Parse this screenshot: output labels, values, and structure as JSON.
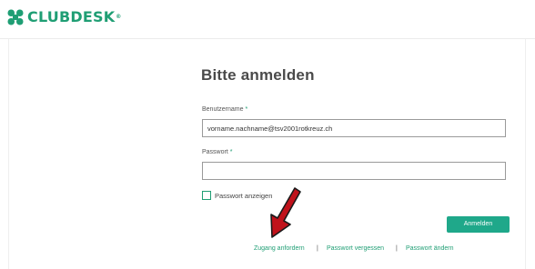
{
  "header": {
    "brand": "CLUBDESK",
    "brand_mark": "®",
    "brand_color": "#1f9e74"
  },
  "login": {
    "title": "Bitte anmelden",
    "username_label": "Benutzername",
    "username_required": "*",
    "username_value": "vorname.nachname@tsv2001rotkreuz.ch",
    "password_label": "Passwort",
    "password_required": "*",
    "password_value": "",
    "show_password_label": "Passwort anzeigen",
    "show_password_checked": false,
    "submit_label": "Anmelden"
  },
  "footer_links": {
    "request_access": "Zugang anfordern",
    "forgot_password": "Passwort vergessen",
    "change_password": "Passwort ändern",
    "separator": "|"
  },
  "annotation": {
    "arrow_color": "#c0121b",
    "arrow_target": "footer_links.request_access"
  },
  "colors": {
    "accent": "#1fa88a",
    "text": "#4a4a4a"
  },
  "icons": {
    "logo": "clover-logo-icon",
    "annotation": "red-arrow-icon"
  }
}
